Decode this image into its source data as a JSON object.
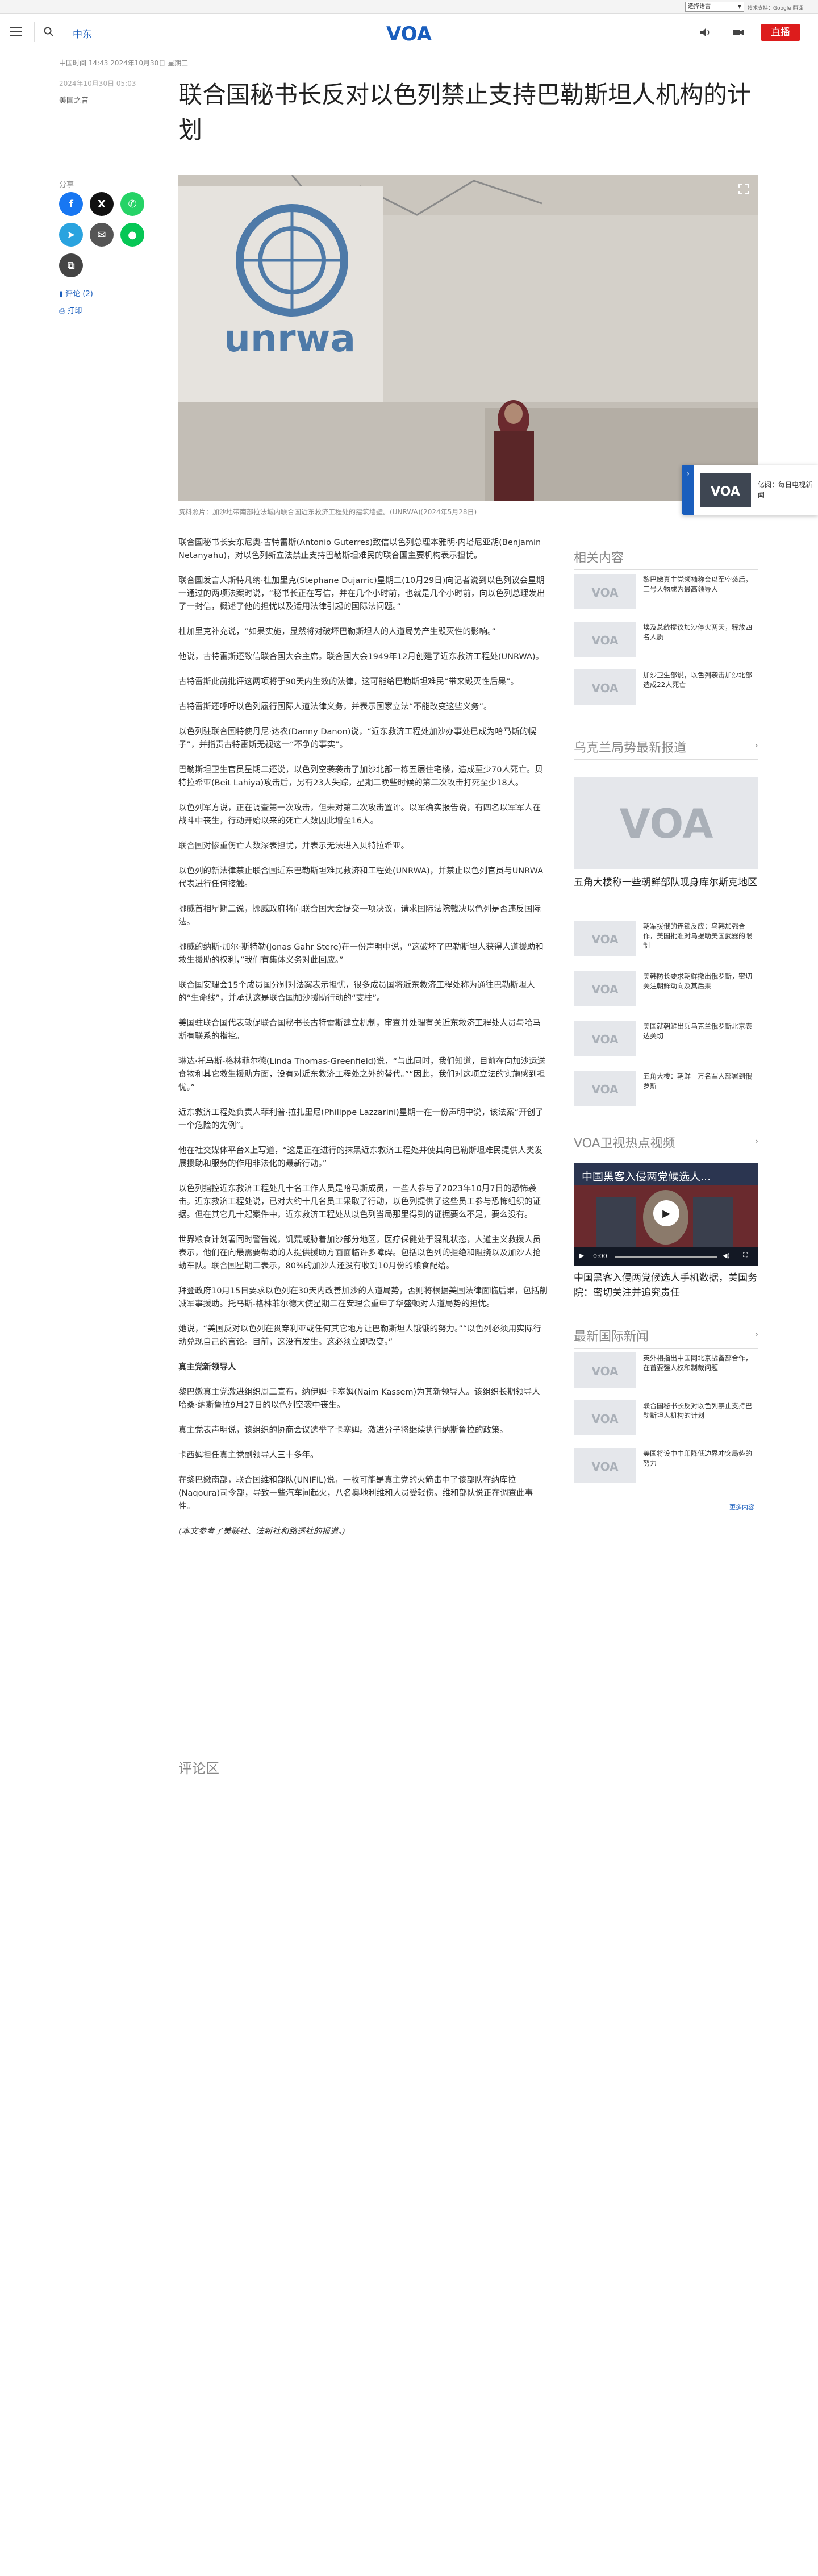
{
  "translate_bar": {
    "select_label": "选择语言",
    "powered_by": "技术支持：Google 翻译"
  },
  "header": {
    "section": "中东",
    "logo_alt": "VOA",
    "live_label": "直播"
  },
  "article": {
    "meta_line": "中国时间 14:43 2024年10月30日 星期三",
    "date_small": "2024年10月30日 05:03",
    "author": "美国之音",
    "title": "联合国秘书长反对以色列禁止支持巴勒斯坦人机构的计划",
    "share_label": "分享",
    "comment_link": "评论 (2)",
    "print_link": "打印",
    "hero_caption": "资料照片：加沙地带南部拉法城内联合国近东救济工程处的建筑墙壁。(UNRWA)(2024年5月28日)",
    "hero_sign_text": "unrwa",
    "paragraphs": [
      "联合国秘书长安东尼奥·古特雷斯(Antonio Guterres)致信以色列总理本雅明·内塔尼亚胡(Benjamin Netanyahu)，对以色列新立法禁止支持巴勒斯坦难民的联合国主要机构表示担忧。",
      "联合国发言人斯特凡纳·杜加里克(Stephane Dujarric)星期二(10月29日)向记者说到以色列议会星期一通过的两项法案时说，“秘书长正在写信，并在几个小时前，也就是几个小时前，向以色列总理发出了一封信，概述了他的担忧以及适用法律引起的国际法问题。”",
      "杜加里克补充说，“如果实施，显然将对破坏巴勒斯坦人的人道局势产生毁灭性的影响。”",
      "他说，古特雷斯还致信联合国大会主席。联合国大会1949年12月创建了近东救济工程处(UNRWA)。",
      "古特雷斯此前批评这两项将于90天内生效的法律，这可能给巴勒斯坦难民“带来毁灭性后果”。",
      "古特雷斯还呼吁以色列履行国际人道法律义务，并表示国家立法“不能改变这些义务”。",
      "以色列驻联合国特使丹尼·达农(Danny Danon)说，“近东救济工程处加沙办事处已成为哈马斯的幌子”，并指责古特雷斯无视这一“不争的事实”。",
      "巴勒斯坦卫生官员星期二还说，以色列空袭袭击了加沙北部一栋五层住宅楼，造成至少70人死亡。贝特拉希亚(Beit Lahiya)攻击后，另有23人失踪，星期二晚些时候的第二次攻击打死至少18人。",
      "以色列军方说，正在调查第一次攻击，但未对第二次攻击置评。以军确实报告说，有四名以军军人在战斗中丧生，行动开始以来的死亡人数因此增至16人。",
      "联合国对惨重伤亡人数深表担忧，并表示无法进入贝特拉希亚。",
      "以色列的新法律禁止联合国近东巴勒斯坦难民救济和工程处(UNRWA)，并禁止以色列官员与UNRWA代表进行任何接触。",
      "挪威首相星期二说，挪威政府将向联合国大会提交一项决议，请求国际法院裁决以色列是否违反国际法。",
      "挪威的纳斯·加尔·斯特勒(Jonas Gahr Stere)在一份声明中说，“这破坏了巴勒斯坦人获得人道援助和救生援助的权利，”我们有集体义务对此回应。”",
      "联合国安理会15个成员国分别对法案表示担忧，很多成员国将近东救济工程处称为通往巴勒斯坦人的“生命线”，并承认这是联合国加沙援助行动的“支柱”。",
      "美国驻联合国代表敦促联合国秘书长古特雷斯建立机制，审查并处理有关近东救济工程处人员与哈马斯有联系的指控。",
      "琳达·托马斯-格林菲尔德(Linda Thomas-Greenfield)说，“与此同时，我们知道，目前在向加沙运送食物和其它救生援助方面，没有对近东救济工程处之外的替代。”“因此，我们对这项立法的实施感到担忧。”",
      "近东救济工程处负责人菲利普·拉扎里尼(Philippe Lazzarini)星期一在一份声明中说，该法案“开创了一个危险的先例”。",
      "他在社交媒体平台X上写道，“这是正在进行的抹黑近东救济工程处并使其向巴勒斯坦难民提供人类发展援助和服务的作用非法化的最新行动。”",
      "以色列指控近东救济工程处几十名工作人员是哈马斯成员，一些人参与了2023年10月7日的恐怖袭击。近东救济工程处说，已对大约十几名员工采取了行动，以色列提供了这些员工参与恐怖组织的证据。但在其它几十起案件中，近东救济工程处从以色列当局那里得到的证据要么不足，要么没有。",
      "世界粮食计划署同时警告说，饥荒威胁着加沙部分地区，医疗保健处于混乱状态，人道主义救援人员表示，他们在向最需要帮助的人提供援助方面面临许多障碍。包括以色列的拒绝和阻挠以及加沙人抢劫车队。联合国星期二表示，80%的加沙人还没有收到10月份的粮食配给。",
      "拜登政府10月15日要求以色列在30天内改善加沙的人道局势，否则将根据美国法律面临后果，包括削减军事援助。托马斯-格林菲尔德大使星期二在安理会重申了华盛顿对人道局势的担忧。",
      "她说，“美国反对以色列在贯穿利亚或任何其它地方让巴勒斯坦人饿饿的努力。”“以色列必须用实际行动兑现自己的言论。目前，这没有发生。这必须立即改变。”",
      "真主党新领导人",
      "黎巴嫩真主党激进组织周二宣布，纳伊姆·卡塞姆(Naim Kassem)为其新领导人。该组织长期领导人哈桑·纳斯鲁拉9月27日的以色列空袭中丧生。",
      "真主党表声明说，该组织的协商会议选举了卡塞姆。激进分子将继续执行纳斯鲁拉的政策。",
      "卡西姆担任真主党副领导人三十多年。",
      "在黎巴嫩南部，联合国维和部队(UNIFIL)说，一枚可能是真主党的火箭击中了该部队在纳库拉(Naqoura)司令部，导致一些汽车间起火，八名奥地利维和人员受轻伤。维和部队说正在调查此事件。",
      "(本文参考了美联社、法新社和路透社的报道。)"
    ],
    "comments_heading": "评论区"
  },
  "sidebar": {
    "related_heading": "相关内容",
    "related": [
      "黎巴嫩真主党领袖称会以军空袭后，三号人物成为最高领导人",
      "埃及总统提议加沙停火两天，释放四名人质",
      "加沙卫生部说，以色列袭击加沙北部造成22人死亡"
    ],
    "ukraine_heading": "乌克兰局势最新报道",
    "ukraine_top_caption": "五角大楼称一些朝鲜部队现身库尔斯克地区",
    "ukraine_items": [
      "朝军援俄的连锁反应：乌韩加强合作，美国批准对乌援助美国武器的限制",
      "美韩防长要求朝鲜撤出俄罗斯，密切关注朝鲜动向及其后果",
      "美国就朝鲜出兵乌克兰俄罗斯北京表达关切",
      "五角大楼：朝鲜一万名军人部署到俄罗斯"
    ],
    "video_heading": "VOA卫视热点视频",
    "video_overlay_title": "中国黑客入侵两党候选人...",
    "video_time": "0:00",
    "video_caption": "中国黑客入侵两党候选人手机数据，美国务院：密切关注并追究责任",
    "intl_heading": "最新国际新闻",
    "intl_items": [
      "英外相指出中国同北京战备部合作，在首要强人权和制裁问题",
      "联合国秘书长反对以色列禁止支持巴勒斯坦人机构的计划",
      "美国将设中中印降低边界冲突局势的努力"
    ],
    "more_link": "更多内容"
  },
  "float_card": {
    "text": "亿阅：每日电视新闻"
  },
  "colors": {
    "accent": "#1a5ebd",
    "live": "#dd1c1c"
  }
}
